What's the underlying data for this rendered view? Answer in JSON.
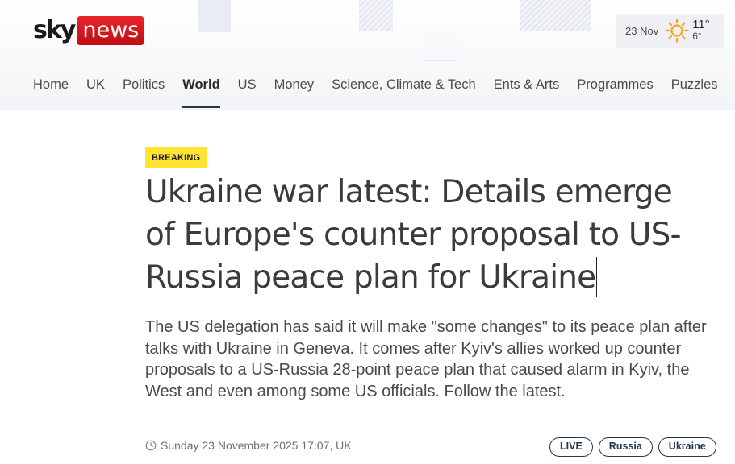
{
  "header": {
    "logo": {
      "sky": "sky",
      "news": "news"
    },
    "weather": {
      "date": "23 Nov",
      "high": "11°",
      "low": "6°",
      "icon": "sun-icon"
    }
  },
  "nav": {
    "items": [
      {
        "label": "Home",
        "active": false
      },
      {
        "label": "UK",
        "active": false
      },
      {
        "label": "Politics",
        "active": false
      },
      {
        "label": "World",
        "active": true
      },
      {
        "label": "US",
        "active": false
      },
      {
        "label": "Money",
        "active": false
      },
      {
        "label": "Science, Climate & Tech",
        "active": false
      },
      {
        "label": "Ents & Arts",
        "active": false
      },
      {
        "label": "Programmes",
        "active": false
      },
      {
        "label": "Puzzles",
        "active": false
      }
    ]
  },
  "article": {
    "badge": "BREAKING",
    "headline": "Ukraine war latest: Details emerge of Europe's counter proposal to US-Russia peace plan for Ukraine",
    "standfirst": "The US delegation has said it will make \"some changes\" to its peace plan after talks with Ukraine in Geneva. It comes after Kyiv's allies worked up counter proposals to a US-Russia 28-point peace plan that caused alarm in Kyiv, the West and even among some US officials. Follow the latest.",
    "timestamp": "Sunday 23 November 2025 17:07, UK",
    "tags": [
      "LIVE",
      "Russia",
      "Ukraine"
    ]
  },
  "colors": {
    "brand_red": "#d4161c",
    "breaking_yellow": "#ffe431",
    "nav_accent": "#23374d"
  }
}
